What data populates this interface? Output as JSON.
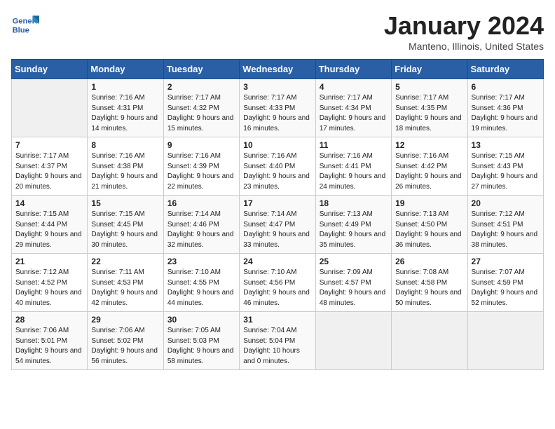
{
  "logo": {
    "line1": "General",
    "line2": "Blue"
  },
  "title": "January 2024",
  "location": "Manteno, Illinois, United States",
  "days_header": [
    "Sunday",
    "Monday",
    "Tuesday",
    "Wednesday",
    "Thursday",
    "Friday",
    "Saturday"
  ],
  "weeks": [
    [
      {
        "num": "",
        "sunrise": "",
        "sunset": "",
        "daylight": ""
      },
      {
        "num": "1",
        "sunrise": "Sunrise: 7:16 AM",
        "sunset": "Sunset: 4:31 PM",
        "daylight": "Daylight: 9 hours and 14 minutes."
      },
      {
        "num": "2",
        "sunrise": "Sunrise: 7:17 AM",
        "sunset": "Sunset: 4:32 PM",
        "daylight": "Daylight: 9 hours and 15 minutes."
      },
      {
        "num": "3",
        "sunrise": "Sunrise: 7:17 AM",
        "sunset": "Sunset: 4:33 PM",
        "daylight": "Daylight: 9 hours and 16 minutes."
      },
      {
        "num": "4",
        "sunrise": "Sunrise: 7:17 AM",
        "sunset": "Sunset: 4:34 PM",
        "daylight": "Daylight: 9 hours and 17 minutes."
      },
      {
        "num": "5",
        "sunrise": "Sunrise: 7:17 AM",
        "sunset": "Sunset: 4:35 PM",
        "daylight": "Daylight: 9 hours and 18 minutes."
      },
      {
        "num": "6",
        "sunrise": "Sunrise: 7:17 AM",
        "sunset": "Sunset: 4:36 PM",
        "daylight": "Daylight: 9 hours and 19 minutes."
      }
    ],
    [
      {
        "num": "7",
        "sunrise": "Sunrise: 7:17 AM",
        "sunset": "Sunset: 4:37 PM",
        "daylight": "Daylight: 9 hours and 20 minutes."
      },
      {
        "num": "8",
        "sunrise": "Sunrise: 7:16 AM",
        "sunset": "Sunset: 4:38 PM",
        "daylight": "Daylight: 9 hours and 21 minutes."
      },
      {
        "num": "9",
        "sunrise": "Sunrise: 7:16 AM",
        "sunset": "Sunset: 4:39 PM",
        "daylight": "Daylight: 9 hours and 22 minutes."
      },
      {
        "num": "10",
        "sunrise": "Sunrise: 7:16 AM",
        "sunset": "Sunset: 4:40 PM",
        "daylight": "Daylight: 9 hours and 23 minutes."
      },
      {
        "num": "11",
        "sunrise": "Sunrise: 7:16 AM",
        "sunset": "Sunset: 4:41 PM",
        "daylight": "Daylight: 9 hours and 24 minutes."
      },
      {
        "num": "12",
        "sunrise": "Sunrise: 7:16 AM",
        "sunset": "Sunset: 4:42 PM",
        "daylight": "Daylight: 9 hours and 26 minutes."
      },
      {
        "num": "13",
        "sunrise": "Sunrise: 7:15 AM",
        "sunset": "Sunset: 4:43 PM",
        "daylight": "Daylight: 9 hours and 27 minutes."
      }
    ],
    [
      {
        "num": "14",
        "sunrise": "Sunrise: 7:15 AM",
        "sunset": "Sunset: 4:44 PM",
        "daylight": "Daylight: 9 hours and 29 minutes."
      },
      {
        "num": "15",
        "sunrise": "Sunrise: 7:15 AM",
        "sunset": "Sunset: 4:45 PM",
        "daylight": "Daylight: 9 hours and 30 minutes."
      },
      {
        "num": "16",
        "sunrise": "Sunrise: 7:14 AM",
        "sunset": "Sunset: 4:46 PM",
        "daylight": "Daylight: 9 hours and 32 minutes."
      },
      {
        "num": "17",
        "sunrise": "Sunrise: 7:14 AM",
        "sunset": "Sunset: 4:47 PM",
        "daylight": "Daylight: 9 hours and 33 minutes."
      },
      {
        "num": "18",
        "sunrise": "Sunrise: 7:13 AM",
        "sunset": "Sunset: 4:49 PM",
        "daylight": "Daylight: 9 hours and 35 minutes."
      },
      {
        "num": "19",
        "sunrise": "Sunrise: 7:13 AM",
        "sunset": "Sunset: 4:50 PM",
        "daylight": "Daylight: 9 hours and 36 minutes."
      },
      {
        "num": "20",
        "sunrise": "Sunrise: 7:12 AM",
        "sunset": "Sunset: 4:51 PM",
        "daylight": "Daylight: 9 hours and 38 minutes."
      }
    ],
    [
      {
        "num": "21",
        "sunrise": "Sunrise: 7:12 AM",
        "sunset": "Sunset: 4:52 PM",
        "daylight": "Daylight: 9 hours and 40 minutes."
      },
      {
        "num": "22",
        "sunrise": "Sunrise: 7:11 AM",
        "sunset": "Sunset: 4:53 PM",
        "daylight": "Daylight: 9 hours and 42 minutes."
      },
      {
        "num": "23",
        "sunrise": "Sunrise: 7:10 AM",
        "sunset": "Sunset: 4:55 PM",
        "daylight": "Daylight: 9 hours and 44 minutes."
      },
      {
        "num": "24",
        "sunrise": "Sunrise: 7:10 AM",
        "sunset": "Sunset: 4:56 PM",
        "daylight": "Daylight: 9 hours and 46 minutes."
      },
      {
        "num": "25",
        "sunrise": "Sunrise: 7:09 AM",
        "sunset": "Sunset: 4:57 PM",
        "daylight": "Daylight: 9 hours and 48 minutes."
      },
      {
        "num": "26",
        "sunrise": "Sunrise: 7:08 AM",
        "sunset": "Sunset: 4:58 PM",
        "daylight": "Daylight: 9 hours and 50 minutes."
      },
      {
        "num": "27",
        "sunrise": "Sunrise: 7:07 AM",
        "sunset": "Sunset: 4:59 PM",
        "daylight": "Daylight: 9 hours and 52 minutes."
      }
    ],
    [
      {
        "num": "28",
        "sunrise": "Sunrise: 7:06 AM",
        "sunset": "Sunset: 5:01 PM",
        "daylight": "Daylight: 9 hours and 54 minutes."
      },
      {
        "num": "29",
        "sunrise": "Sunrise: 7:06 AM",
        "sunset": "Sunset: 5:02 PM",
        "daylight": "Daylight: 9 hours and 56 minutes."
      },
      {
        "num": "30",
        "sunrise": "Sunrise: 7:05 AM",
        "sunset": "Sunset: 5:03 PM",
        "daylight": "Daylight: 9 hours and 58 minutes."
      },
      {
        "num": "31",
        "sunrise": "Sunrise: 7:04 AM",
        "sunset": "Sunset: 5:04 PM",
        "daylight": "Daylight: 10 hours and 0 minutes."
      },
      {
        "num": "",
        "sunrise": "",
        "sunset": "",
        "daylight": ""
      },
      {
        "num": "",
        "sunrise": "",
        "sunset": "",
        "daylight": ""
      },
      {
        "num": "",
        "sunrise": "",
        "sunset": "",
        "daylight": ""
      }
    ]
  ]
}
